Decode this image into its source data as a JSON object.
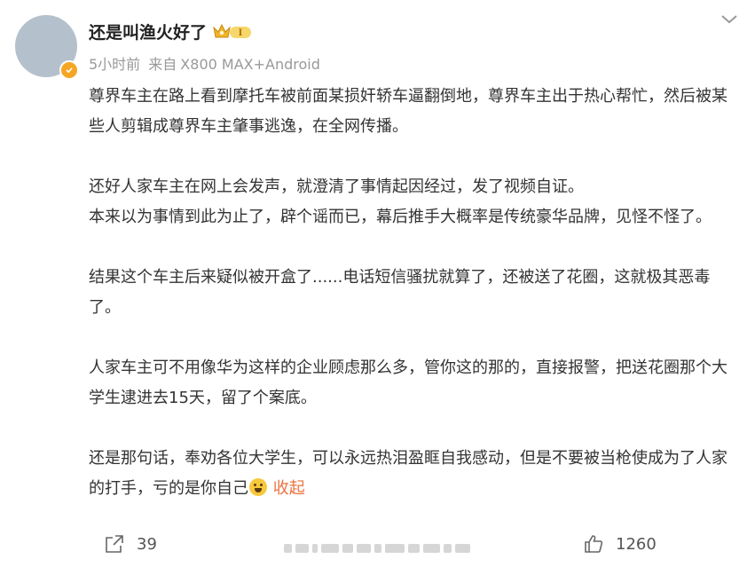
{
  "post": {
    "author": "还是叫渔火好了",
    "time": "5小时前",
    "source_prefix": "来自",
    "source": "X800 MAX+Android",
    "paragraphs": [
      "尊界车主在路上看到摩托车被前面某损奸轿车逼翻倒地，尊界车主出于热心帮忙，然后被某些人剪辑成尊界车主肇事逃逸，在全网传播。",
      "还好人家车主在网上会发声，就澄清了事情起因经过，发了视频自证。",
      "本来以为事情到此为止了，辟个谣而已，幕后推手大概率是传统豪华品牌，见怪不怪了。",
      "结果这个车主后来疑似被开盒了......电话短信骚扰就算了，还被送了花圈，这就极其恶毒了。",
      "人家车主可不用像华为这样的企业顾虑那么多，管你这的那的，直接报警，把送花圈那个大学生逮进去15天，留了个案底。",
      "还是那句话，奉劝各位大学生，可以永远热泪盈眶自我感动，但是不要被当枪使成为了人家的打手，亏的是你自己"
    ],
    "collapse_label": "收起",
    "badge_level": "I"
  },
  "footer": {
    "repost_count": "39",
    "like_count": "1260"
  },
  "icons": {
    "more": "chevron-down-icon",
    "repost": "share-icon",
    "like": "thumb-up-icon",
    "emoji": "shushing-face-icon"
  },
  "colors": {
    "link": "#eb7340",
    "meta": "#999999",
    "avatar_bg": "#b4c1cc",
    "badge": "#f5a623"
  }
}
